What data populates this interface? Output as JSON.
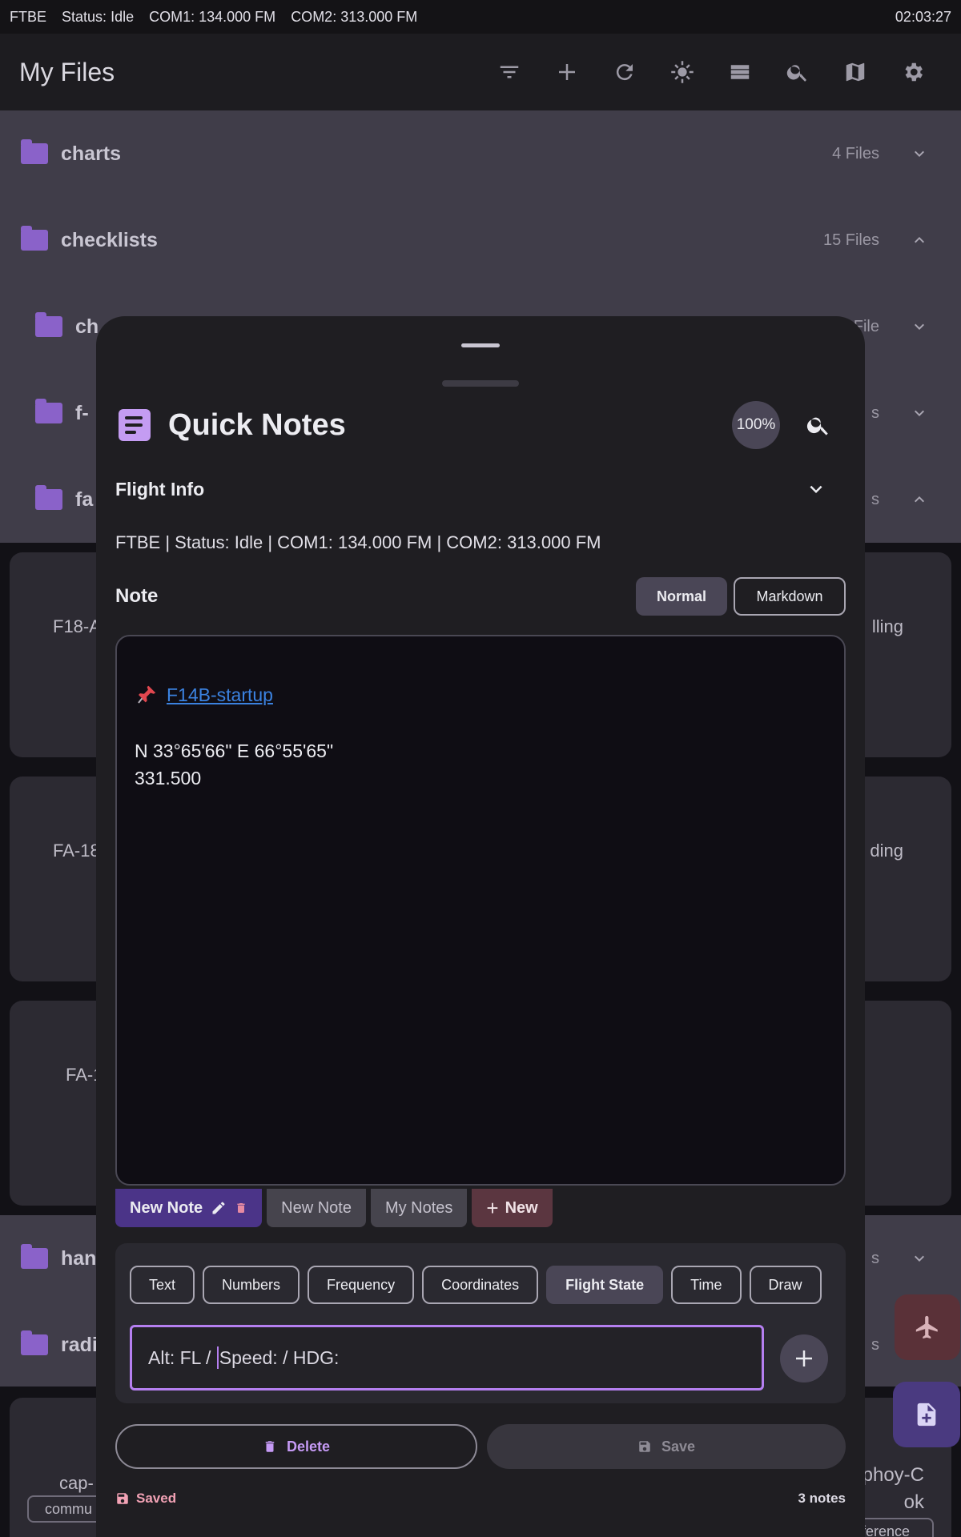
{
  "status_bar": {
    "items": [
      "FTBE",
      "Status: Idle",
      "COM1: 134.000 FM",
      "COM2: 313.000 FM"
    ],
    "time": "02:03:27"
  },
  "app_bar": {
    "title": "My Files",
    "icons": [
      "filter-icon",
      "add-icon",
      "refresh-icon",
      "brightness-icon",
      "list-view-icon",
      "search-icon",
      "map-icon",
      "settings-icon"
    ]
  },
  "background": {
    "folders": [
      {
        "name": "charts",
        "count": "4 Files"
      },
      {
        "name": "checklists",
        "count": "15 Files"
      },
      {
        "name": "ch",
        "count": "File"
      },
      {
        "name": "f-",
        "count": "s"
      },
      {
        "name": "fa",
        "count": "s"
      },
      {
        "name": "han",
        "count": "s"
      },
      {
        "name": "radi",
        "count": "s"
      }
    ],
    "cards": [
      {
        "left": "F18-A",
        "right": "lling"
      },
      {
        "left": "FA-18",
        "right": "ding"
      },
      {
        "left": "FA-1",
        "right": ""
      }
    ],
    "bottom_card": {
      "left": "cap-",
      "right_line1": "ephoy-C",
      "right_line2": "ok",
      "chip_left": "commu",
      "chip_right": "ference"
    }
  },
  "sheet": {
    "title": "Quick Notes",
    "zoom": "100%",
    "flight_info": {
      "label": "Flight Info",
      "text": "FTBE  | Status: Idle  | COM1: 134.000 FM  | COM2: 313.000 FM"
    },
    "note": {
      "label": "Note",
      "modes": [
        "Normal",
        "Markdown"
      ],
      "selected_mode": "Normal",
      "pin_emoji": "📌",
      "link_text": "F14B-startup",
      "coordinates": "N 33°65'66\" E 66°55'65\"",
      "frequency": "331.500"
    },
    "tabs": {
      "active": "New Note",
      "others": [
        "New Note",
        "My Notes"
      ],
      "new_label": "New",
      "new_plus": "+"
    },
    "quick_insert": {
      "chips": [
        "Text",
        "Numbers",
        "Frequency",
        "Coordinates",
        "Flight State",
        "Time",
        "Draw"
      ],
      "selected": "Flight State",
      "input_before_caret": "Alt: FL / ",
      "input_after_caret": "Speed: / HDG:"
    },
    "actions": {
      "delete": "Delete",
      "save": "Save"
    },
    "footer": {
      "saved": "Saved",
      "count": "3 notes"
    }
  }
}
